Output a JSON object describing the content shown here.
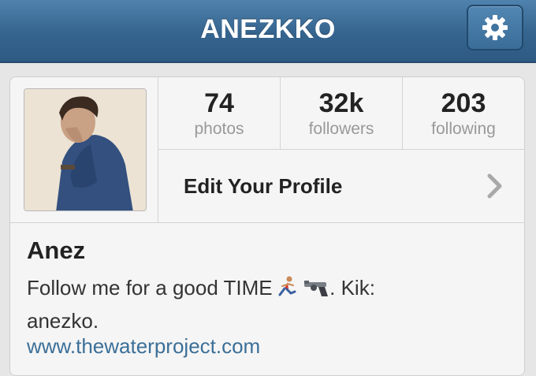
{
  "header": {
    "title": "ANEZKKO",
    "settings_icon": "gear-icon"
  },
  "stats": [
    {
      "value": "74",
      "label": "photos"
    },
    {
      "value": "32k",
      "label": "followers"
    },
    {
      "value": "203",
      "label": "following"
    }
  ],
  "edit_profile": {
    "label": "Edit Your Profile",
    "icon": "chevron-right-icon"
  },
  "bio": {
    "name": "Anez",
    "text_before_emoji": "Follow me for a good TIME",
    "emojis": [
      "runner-emoji",
      "pistol-emoji"
    ],
    "text_after_emoji": ". Kik:",
    "text_line2": "anezko.",
    "link": "www.thewaterproject.com"
  },
  "colors": {
    "navbar": "#35648e",
    "link": "#3b6f98",
    "muted_text": "#999999"
  }
}
